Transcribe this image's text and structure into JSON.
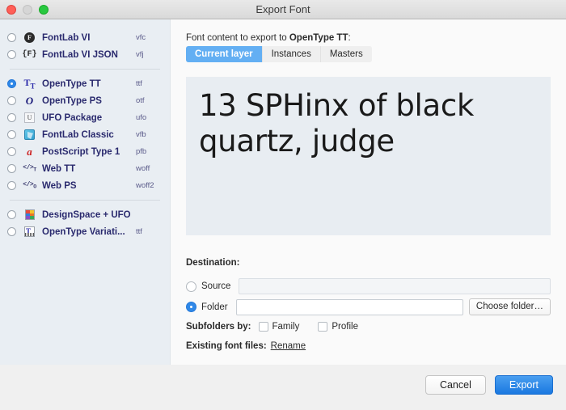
{
  "window": {
    "title": "Export Font",
    "traffic_lights": [
      "close-button",
      "minimize-button",
      "zoom-button"
    ]
  },
  "sidebar": {
    "groups": [
      {
        "items": [
          {
            "label": "FontLab VI",
            "ext": "vfc",
            "icon": "fontlab-circle-icon",
            "selected": false
          },
          {
            "label": "FontLab VI JSON",
            "ext": "vfj",
            "icon": "fontlab-json-icon",
            "selected": false
          }
        ]
      },
      {
        "items": [
          {
            "label": "OpenType TT",
            "ext": "ttf",
            "icon": "opentype-tt-icon",
            "selected": true
          },
          {
            "label": "OpenType PS",
            "ext": "otf",
            "icon": "opentype-ps-icon",
            "selected": false
          },
          {
            "label": "UFO Package",
            "ext": "ufo",
            "icon": "ufo-icon",
            "selected": false
          },
          {
            "label": "FontLab Classic",
            "ext": "vfb",
            "icon": "fontlab-classic-icon",
            "selected": false
          },
          {
            "label": "PostScript Type 1",
            "ext": "pfb",
            "icon": "postscript-type1-icon",
            "selected": false
          },
          {
            "label": "Web TT",
            "ext": "woff",
            "icon": "web-tt-icon",
            "selected": false
          },
          {
            "label": "Web PS",
            "ext": "woff2",
            "icon": "web-ps-icon",
            "selected": false
          }
        ]
      },
      {
        "items": [
          {
            "label": "DesignSpace + UFO",
            "ext": "",
            "icon": "designspace-ufo-icon",
            "selected": false
          },
          {
            "label": "OpenType Variati...",
            "ext": "ttf",
            "icon": "opentype-variations-icon",
            "selected": false
          }
        ]
      }
    ]
  },
  "panel": {
    "content_label_prefix": "Font content to export to ",
    "content_label_format": "OpenType TT",
    "content_label_suffix": ":",
    "tabs": [
      {
        "label": "Current layer",
        "active": true
      },
      {
        "label": "Instances",
        "active": false
      },
      {
        "label": "Masters",
        "active": false
      }
    ],
    "preview_text": "13 SPHinx of black quartz, judge",
    "destination": {
      "label": "Destination:",
      "source": {
        "label": "Source",
        "selected": false,
        "path_value": "",
        "enabled": false
      },
      "folder": {
        "label": "Folder",
        "selected": true,
        "path_value": "",
        "enabled": true
      },
      "choose_folder_label": "Choose folder…"
    },
    "subfolders": {
      "label": "Subfolders by:",
      "options": [
        {
          "label": "Family",
          "checked": false
        },
        {
          "label": "Profile",
          "checked": false
        }
      ]
    },
    "existing_files": {
      "label": "Existing font files:",
      "action_label": "Rename"
    }
  },
  "footer": {
    "cancel_label": "Cancel",
    "export_label": "Export"
  },
  "colors": {
    "accent_blue": "#2f88e8",
    "tab_active": "#63aff3",
    "primary_button": "#1a78e0",
    "sidebar_bg": "#e9eef3",
    "preview_bg": "#e8edf2",
    "label_navy": "#2a2a6e"
  }
}
